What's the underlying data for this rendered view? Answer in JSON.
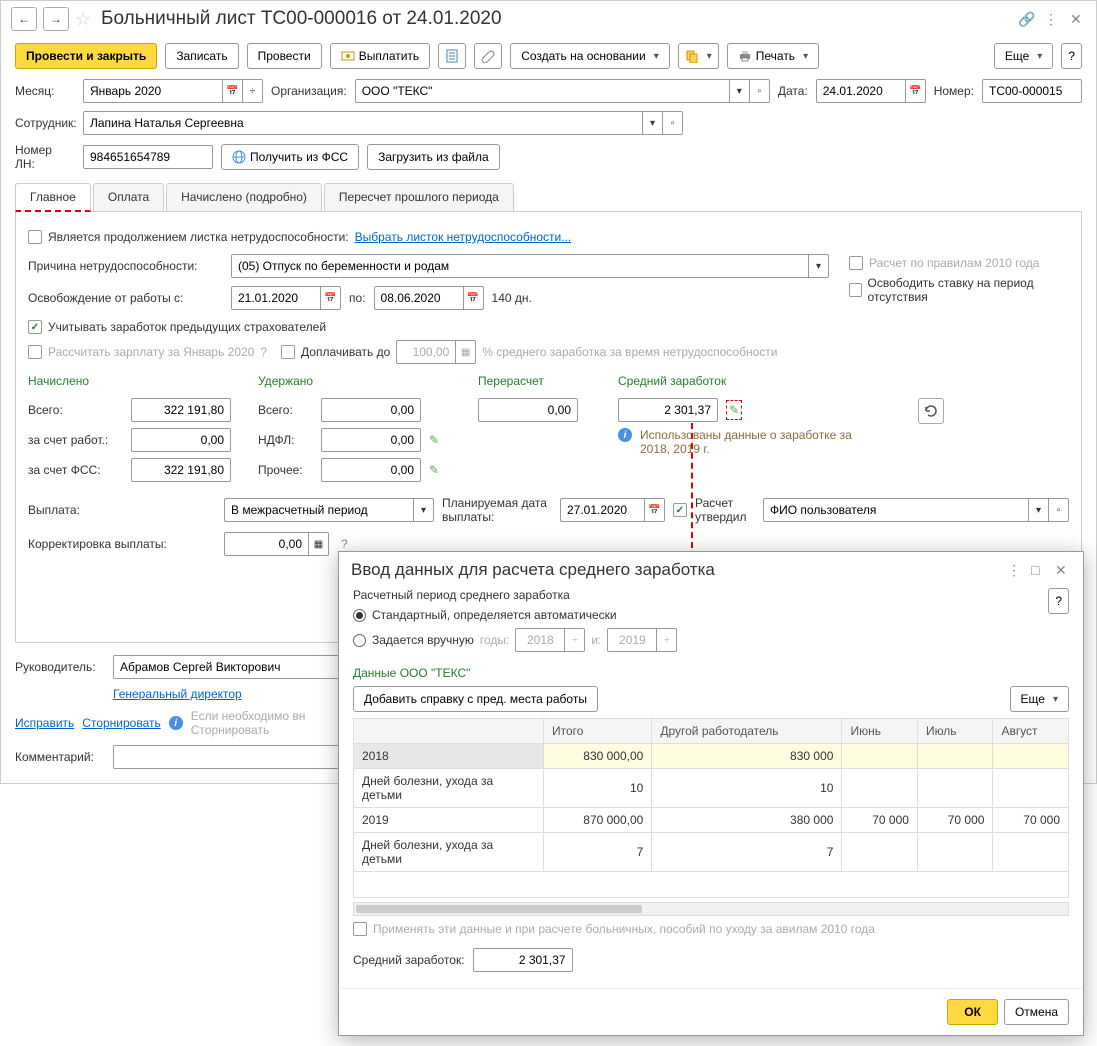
{
  "header": {
    "title": "Больничный лист ТС00-000016 от 24.01.2020"
  },
  "toolbar": {
    "post_close": "Провести и закрыть",
    "save": "Записать",
    "post": "Провести",
    "pay": "Выплатить",
    "create_based": "Создать на основании",
    "print": "Печать",
    "more": "Еще"
  },
  "fields": {
    "month_lbl": "Месяц:",
    "month": "Январь 2020",
    "org_lbl": "Организация:",
    "org": "ООО \"ТЕКС\"",
    "date_lbl": "Дата:",
    "date": "24.01.2020",
    "number_lbl": "Номер:",
    "number": "ТС00-000015",
    "employee_lbl": "Сотрудник:",
    "employee": "Лапина Наталья Сергеевна",
    "ln_lbl": "Номер ЛН:",
    "ln": "984651654789",
    "get_fss": "Получить из ФСС",
    "load_file": "Загрузить из файла"
  },
  "tabs": {
    "main": "Главное",
    "payment": "Оплата",
    "accrued": "Начислено (подробно)",
    "recalc": "Пересчет прошлого периода"
  },
  "main": {
    "is_continuation": "Является продолжением листка нетрудоспособности:",
    "select_sheet": "Выбрать листок нетрудоспособности...",
    "reason_lbl": "Причина нетрудоспособности:",
    "reason": "(05) Отпуск по беременности и родам",
    "calc_2010": "Расчет по правилам 2010 года",
    "free_rate": "Освободить ставку на период отсутствия",
    "absence_lbl": "Освобождение от работы с:",
    "date_from": "21.01.2020",
    "date_to_lbl": "по:",
    "date_to": "08.06.2020",
    "days": "140 дн.",
    "use_prev": "Учитывать заработок предыдущих страхователей",
    "calc_salary": "Рассчитать зарплату за Январь 2020",
    "supplement": "Доплачивать до",
    "supplement_val": "100,00",
    "supplement_hint": "% среднего заработка за время нетрудоспособности",
    "accrued_hdr": "Начислено",
    "withheld_hdr": "Удержано",
    "recalc_hdr": "Перерасчет",
    "avg_hdr": "Средний заработок",
    "total_lbl": "Всего:",
    "total_accrued": "322 191,80",
    "employer_lbl": "за счет работ.:",
    "employer_val": "0,00",
    "fss_lbl": "за счет ФСС:",
    "fss_val": "322 191,80",
    "withheld_total": "0,00",
    "ndfl_lbl": "НДФЛ:",
    "ndfl_val": "0,00",
    "other_lbl": "Прочее:",
    "other_val": "0,00",
    "recalc_val": "0,00",
    "avg_val": "2 301,37",
    "avg_info": "Использованы данные о заработке за 2018,   2019 г.",
    "payout_lbl": "Выплата:",
    "payout": "В межрасчетный период",
    "plan_date_lbl": "Планируемая дата выплаты:",
    "plan_date": "27.01.2020",
    "approved_lbl": "Расчет утвердил",
    "approved_user": "ФИО пользователя",
    "correction_lbl": "Корректировка выплаты:",
    "correction_val": "0,00"
  },
  "footer": {
    "manager_lbl": "Руководитель:",
    "manager": "Абрамов Сергей Викторович",
    "position": "Генеральный директор",
    "correct": "Исправить",
    "reverse": "Сторнировать",
    "hint": "Если необходимо вн",
    "hint2": "Сторнировать",
    "comment_lbl": "Комментарий:"
  },
  "modal": {
    "title": "Ввод данных для расчета среднего заработка",
    "period_lbl": "Расчетный период среднего заработка",
    "auto": "Стандартный, определяется автоматически",
    "manual": "Задается вручную",
    "years_lbl": "годы:",
    "year1": "2018",
    "and": "и:",
    "year2": "2019",
    "data_hdr": "Данные ООО \"ТЕКС\"",
    "add_ref": "Добавить справку с пред. места работы",
    "more": "Еще",
    "cols": {
      "total": "Итого",
      "other": "Другой работодатель",
      "jun": "Июнь",
      "jul": "Июль",
      "aug": "Август"
    },
    "rows": [
      {
        "label": "2018",
        "total": "830 000,00",
        "other": "830 000",
        "jun": "",
        "jul": "",
        "aug": ""
      },
      {
        "label": "Дней болезни, ухода за детьми",
        "total": "10",
        "other": "10",
        "jun": "",
        "jul": "",
        "aug": ""
      },
      {
        "label": "2019",
        "total": "870 000,00",
        "other": "380 000",
        "jun": "70 000",
        "jul": "70 000",
        "aug": "70 000"
      },
      {
        "label": "Дней болезни, ухода за детьми",
        "total": "7",
        "other": "7",
        "jun": "",
        "jul": "",
        "aug": ""
      }
    ],
    "apply_check": "Применять эти данные и при расчете больничных, пособий по уходу за            авилам 2010 года",
    "avg_lbl": "Средний заработок:",
    "avg_val": "2 301,37",
    "ok": "ОК",
    "cancel": "Отмена"
  }
}
